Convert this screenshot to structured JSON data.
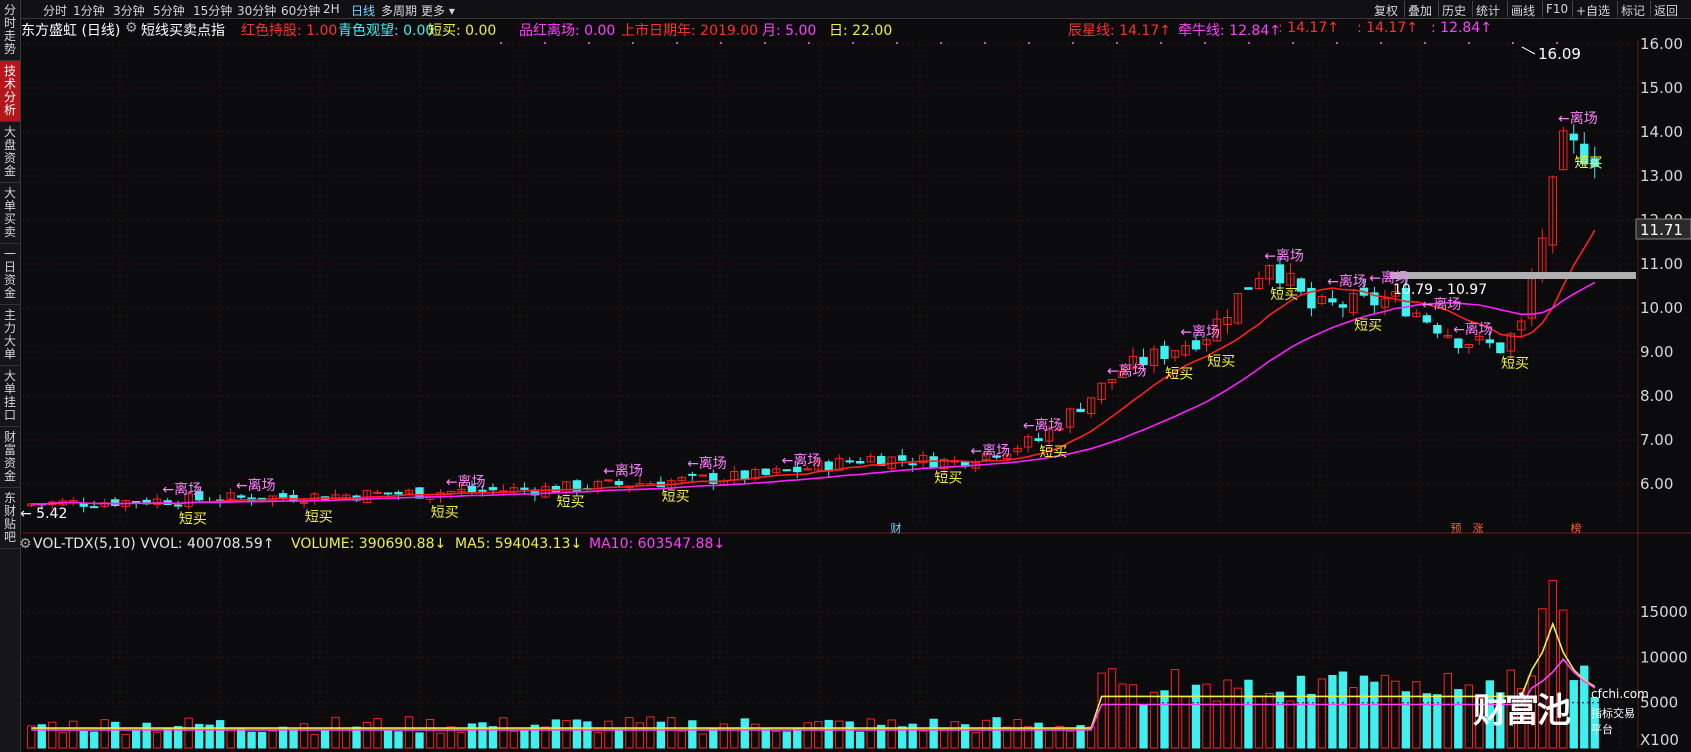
{
  "sidebar": {
    "items": [
      {
        "label": "分时走势"
      },
      {
        "label": "技术分析",
        "active": true
      },
      {
        "label": "大盘资金"
      },
      {
        "label": "大单买卖"
      },
      {
        "label": "一日资金"
      },
      {
        "label": "主力大单"
      },
      {
        "label": "大单挂口"
      },
      {
        "label": "财富资金"
      },
      {
        "label": "东财贴吧"
      }
    ]
  },
  "topbar": {
    "timeframes": [
      "分时",
      "1分钟",
      "3分钟",
      "5分钟",
      "15分钟",
      "30分钟",
      "60分钟",
      "2H",
      "日线",
      "多周期",
      "更多 ▾"
    ],
    "active": "日线",
    "right_items": [
      "复权",
      "叠加",
      "历史",
      "统计",
      "画线",
      "F10",
      "+自选",
      "标记",
      "返回"
    ]
  },
  "indicator_bar": {
    "title": "东方盛虹 (日线)",
    "formula": "短线买卖点指",
    "items": [
      {
        "text": "红色持股: 1.00",
        "color": "#ff3030"
      },
      {
        "text": "青色观望: 0.00",
        "color": "#3ff0f0"
      },
      {
        "text": "短买: 0.00",
        "color": "#f0f040"
      },
      {
        "text": "品红离场: 0.00",
        "color": "#ff40ff"
      },
      {
        "text": "上市日期年: 2019.00",
        "color": "#ff3030"
      },
      {
        "text": "月: 5.00",
        "color": "#ff40ff"
      },
      {
        "text": "日: 22.00",
        "color": "#f0f040"
      }
    ],
    "right_items": [
      {
        "text": "辰星线: 14.17↑",
        "color": "#ff3030"
      },
      {
        "text": "牵牛线: 12.84↑",
        "color": "#ff40ff"
      },
      {
        "text": ": 14.17↑",
        "color": "#ff3030"
      },
      {
        "text": ": 14.17↑",
        "color": "#ff3030"
      },
      {
        "text": ": 12.84↑",
        "color": "#ff40ff"
      }
    ]
  },
  "price_axis": {
    "ticks": [
      "16.00",
      "15.00",
      "14.00",
      "13.00",
      "12.00",
      "11.00",
      "10.00",
      "9.00",
      "8.00",
      "7.00",
      "6.00"
    ],
    "current_price": "11.71",
    "high_label": "16.09",
    "low_label": "← 5.42",
    "zone_label": "10.79 - 10.97"
  },
  "volume_bar": {
    "items": [
      {
        "text": "VOL-TDX(5,10) VVOL: 400708.59↑",
        "color": "#e6e6e6"
      },
      {
        "text": "VOLUME: 390690.88↓",
        "color": "#f0f040"
      },
      {
        "text": "MA5: 594043.13↓",
        "color": "#f0f040"
      },
      {
        "text": "MA10: 603547.88↓",
        "color": "#ff40ff"
      }
    ],
    "ticks": [
      "15000",
      "10000",
      "5000"
    ],
    "unit": "X100"
  },
  "signals": {
    "leave": "←离场",
    "buy": "短买",
    "event_marks": [
      "财",
      "预",
      "涨",
      "榜"
    ]
  },
  "watermark": {
    "main": "财富池",
    "site": "cfchi.com",
    "sub": "指标交易平台"
  },
  "colors": {
    "up": "#ff2020",
    "down": "#3ff0f0",
    "hold": "#ff2020",
    "watch": "#3ff0f0",
    "buy": "#f0f040",
    "leave": "#ff80ff",
    "ma_short": "#ff2020",
    "ma_long": "#ff20ff"
  }
}
